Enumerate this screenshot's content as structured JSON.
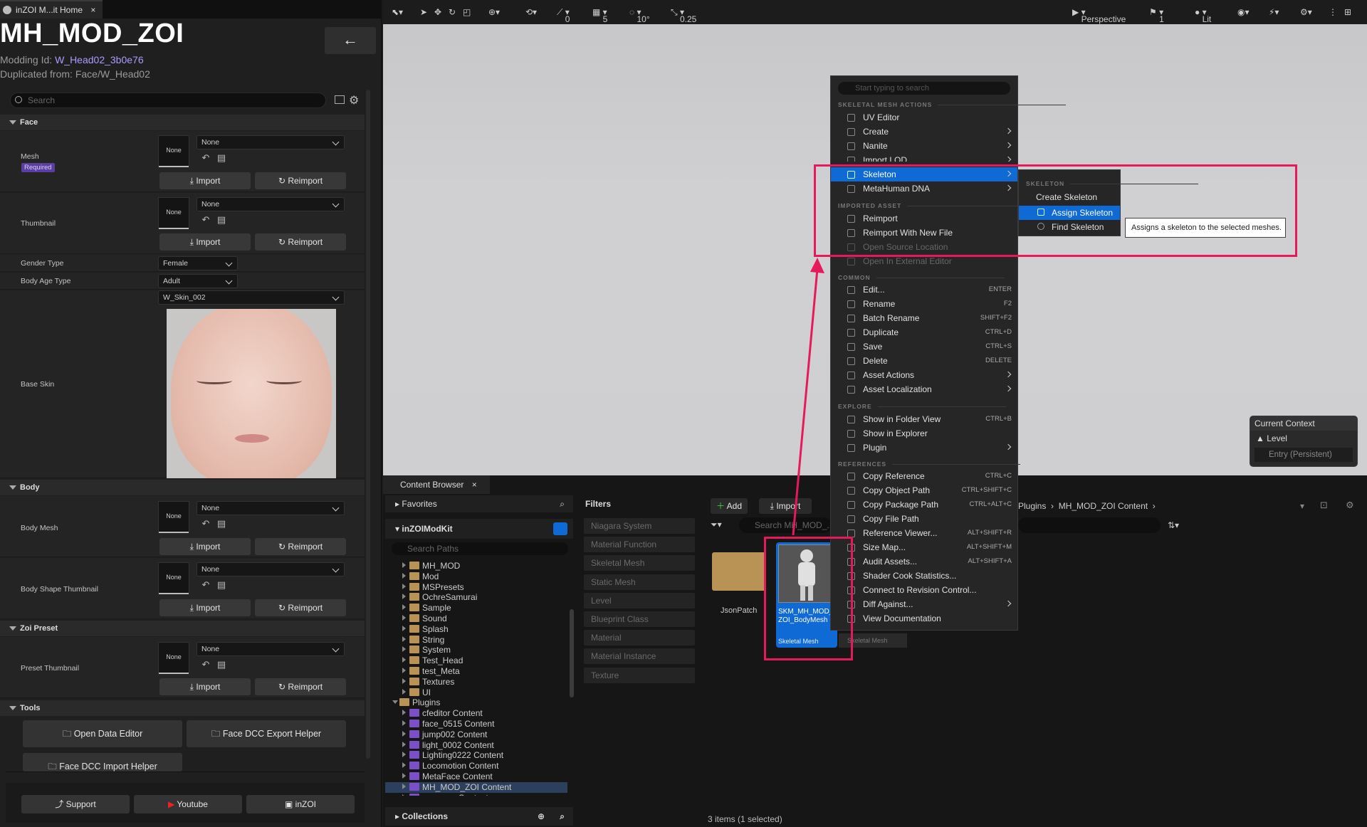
{
  "left_tab": {
    "title": "inZOI M...it Home",
    "close": "×"
  },
  "header": {
    "title": "MH_MOD_ZOI",
    "modding_id_label": "Modding Id:",
    "modding_id_value": "W_Head02_3b0e76",
    "duplicated_from": "Duplicated from: Face/W_Head02",
    "back_icon": "←"
  },
  "search": {
    "placeholder": "Search"
  },
  "sections": {
    "face": "Face",
    "body": "Body",
    "zoi_preset": "Zoi Preset",
    "tools": "Tools"
  },
  "face": {
    "mesh_label": "Mesh",
    "required_badge": "Required",
    "thumbnail_label": "Thumbnail",
    "gender_label": "Gender Type",
    "gender_value": "Female",
    "age_label": "Body Age Type",
    "age_value": "Adult",
    "skin_value": "W_Skin_002",
    "base_skin_label": "Base Skin"
  },
  "body": {
    "mesh_label": "Body Mesh",
    "shape_thumb_label": "Body Shape Thumbnail"
  },
  "preset": {
    "thumb_label": "Preset Thumbnail"
  },
  "common": {
    "none": "None",
    "import": "Import",
    "reimport": "Reimport"
  },
  "tools": {
    "open_data_editor": "Open Data Editor",
    "face_dcc_export": "Face DCC Export Helper",
    "face_dcc_import": "Face DCC Import Helper"
  },
  "footer": {
    "support": "Support",
    "youtube": "Youtube",
    "inzoi": "inZOI"
  },
  "viewport_toolbar": {
    "grid_snap": "0",
    "num_5": "5",
    "rot_snap": "10°",
    "scale_snap": "0.25",
    "perspective": "Perspective",
    "cam_speed": "1",
    "lit": "Lit"
  },
  "current_context": {
    "title": "Current Context",
    "level": "Level",
    "entry": "Entry (Persistent)"
  },
  "content_browser": {
    "tab": "Content Browser",
    "favorites": "Favorites",
    "project": "inZOIModKit",
    "search_paths": "Search Paths",
    "filters_title": "Filters",
    "add": "Add",
    "import": "Import",
    "search_assets": "Search MH_MOD_...",
    "breadcrumb_plugins": "Plugins",
    "breadcrumb_content": "MH_MOD_ZOI Content",
    "collections": "Collections",
    "status": "3 items (1 selected)",
    "tree": [
      "MH_MOD",
      "Mod",
      "MSPresets",
      "OchreSamurai",
      "Sample",
      "Sound",
      "Splash",
      "String",
      "System",
      "Test_Head",
      "test_Meta",
      "Textures",
      "UI",
      "Plugins",
      "cfeditor Content",
      "face_0515 Content",
      "jump002 Content",
      "light_0002 Content",
      "Lighting0222 Content",
      "Locomotion Content",
      "MetaFace Content",
      "MH_MOD_ZOI Content",
      "mocasss Content"
    ],
    "filters": [
      "Niagara System",
      "Material Function",
      "Skeletal Mesh",
      "Static Mesh",
      "Level",
      "Blueprint Class",
      "Material",
      "Material Instance",
      "Texture"
    ],
    "folder_label": "JsonPatch",
    "asset_name": "SKM_MH_MOD_ZOI_BodyMesh",
    "asset_type": "Skeletal Mesh",
    "asset_type_behind": "Skeletal Mesh"
  },
  "context_menu": {
    "search_placeholder": "Start typing to search",
    "h_skeletal": "SKELETAL MESH ACTIONS",
    "h_imported": "IMPORTED ASSET",
    "h_common": "COMMON",
    "h_explore": "EXPLORE",
    "h_references": "REFERENCES",
    "uv_editor": "UV Editor",
    "create": "Create",
    "nanite": "Nanite",
    "import_lod": "Import LOD",
    "skeleton": "Skeleton",
    "metahuman_dna": "MetaHuman DNA",
    "reimport": "Reimport",
    "reimport_new": "Reimport With New File",
    "open_source": "Open Source Location",
    "open_external": "Open In External Editor",
    "edit": "Edit...",
    "edit_sc": "ENTER",
    "rename": "Rename",
    "rename_sc": "F2",
    "batch_rename": "Batch Rename",
    "batch_sc": "SHIFT+F2",
    "duplicate": "Duplicate",
    "duplicate_sc": "CTRL+D",
    "save": "Save",
    "save_sc": "CTRL+S",
    "delete": "Delete",
    "delete_sc": "DELETE",
    "asset_actions": "Asset Actions",
    "asset_localization": "Asset Localization",
    "show_folder": "Show in Folder View",
    "show_folder_sc": "CTRL+B",
    "show_explorer": "Show in Explorer",
    "plugin": "Plugin",
    "copy_ref": "Copy Reference",
    "copy_ref_sc": "CTRL+C",
    "copy_obj": "Copy Object Path",
    "copy_obj_sc": "CTRL+SHIFT+C",
    "copy_pkg": "Copy Package Path",
    "copy_pkg_sc": "CTRL+ALT+C",
    "copy_file": "Copy File Path",
    "ref_viewer": "Reference Viewer...",
    "ref_viewer_sc": "ALT+SHIFT+R",
    "size_map": "Size Map...",
    "size_map_sc": "ALT+SHIFT+M",
    "audit": "Audit Assets...",
    "audit_sc": "ALT+SHIFT+A",
    "shader_cook": "Shader Cook Statistics...",
    "revision": "Connect to Revision Control...",
    "diff": "Diff Against...",
    "docs": "View Documentation"
  },
  "submenu": {
    "header": "SKELETON",
    "create": "Create Skeleton",
    "assign": "Assign Skeleton",
    "find": "Find Skeleton",
    "tooltip": "Assigns a skeleton to the selected meshes."
  },
  "colors": {
    "accent": "#0f6ad6",
    "highlight": "#e6195a",
    "link": "#a99cff"
  }
}
